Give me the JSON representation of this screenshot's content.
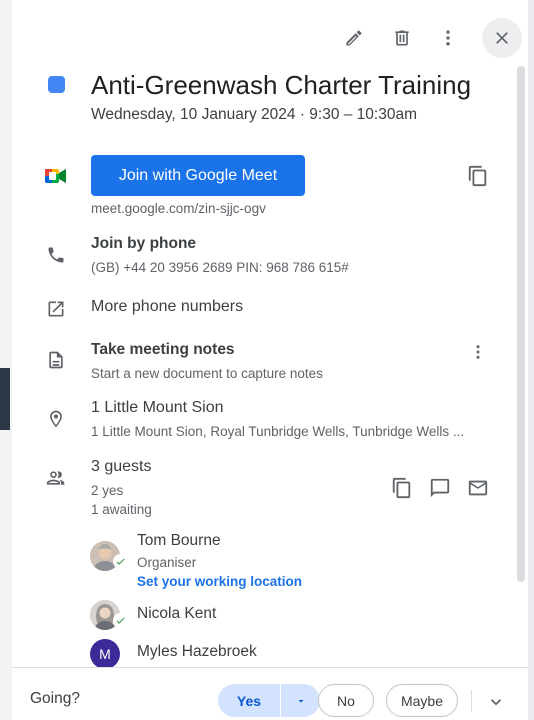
{
  "colors": {
    "accent": "#1a73e8",
    "event_color": "#4285f4",
    "avatar_m_bg": "#3b2a98",
    "yes_bg": "#d3e3fd",
    "accepted_check": "#1e8e3e"
  },
  "toolbar": {
    "edit_icon": "pencil-icon",
    "delete_icon": "trash-icon",
    "options_icon": "more-vert-icon",
    "close_icon": "close-icon"
  },
  "event": {
    "title": "Anti-Greenwash Charter Training",
    "datetime": "Wednesday, 10 January 2024  ·  9:30 – 10:30am"
  },
  "meet": {
    "button_label": "Join with Google Meet",
    "url": "meet.google.com/zin-sjjc-ogv"
  },
  "phone": {
    "label": "Join by phone",
    "details": "(GB) +44 20 3956 2689 PIN: 968 786 615#"
  },
  "more_numbers": {
    "label": "More phone numbers"
  },
  "notes": {
    "label": "Take meeting notes",
    "subtitle": "Start a new document to capture notes"
  },
  "location": {
    "name": "1 Little Mount Sion",
    "address": "1 Little Mount Sion, Royal Tunbridge Wells, Tunbridge Wells ..."
  },
  "guests": {
    "summary": "3 guests",
    "yes_count": "2 yes",
    "awaiting_count": "1 awaiting",
    "list": [
      {
        "name": "Tom Bourne",
        "role": "Organiser",
        "link": "Set your working location"
      },
      {
        "name": "Nicola Kent"
      },
      {
        "name": "Myles Hazebroek",
        "initial": "M"
      }
    ]
  },
  "footer": {
    "going_label": "Going?",
    "yes_label": "Yes",
    "no_label": "No",
    "maybe_label": "Maybe"
  }
}
